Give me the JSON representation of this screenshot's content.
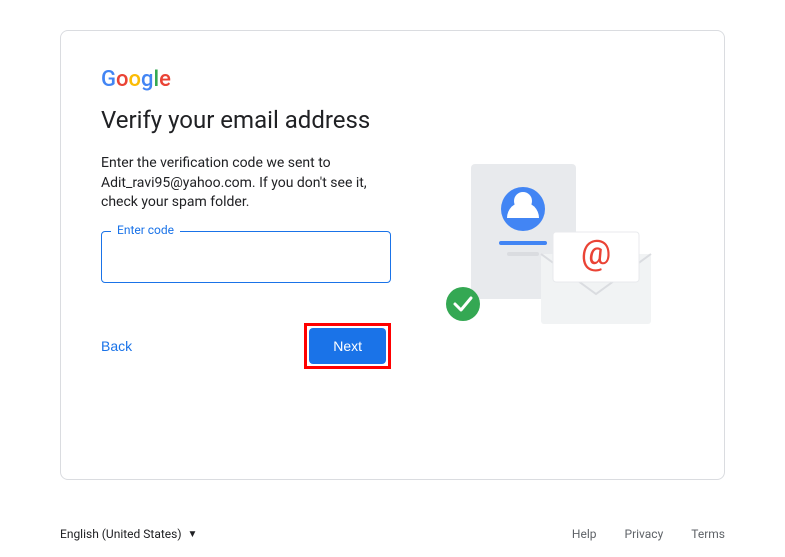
{
  "logo": {
    "g1": "G",
    "o1": "o",
    "o2": "o",
    "g2": "g",
    "l": "l",
    "e": "e"
  },
  "heading": "Verify your email address",
  "description": "Enter the verification code we sent to Adit_ravi95@yahoo.com. If you don't see it, check your spam folder.",
  "input": {
    "label": "Enter code",
    "value": ""
  },
  "buttons": {
    "back": "Back",
    "next": "Next"
  },
  "footer": {
    "language": "English (United States)",
    "links": {
      "help": "Help",
      "privacy": "Privacy",
      "terms": "Terms"
    }
  }
}
